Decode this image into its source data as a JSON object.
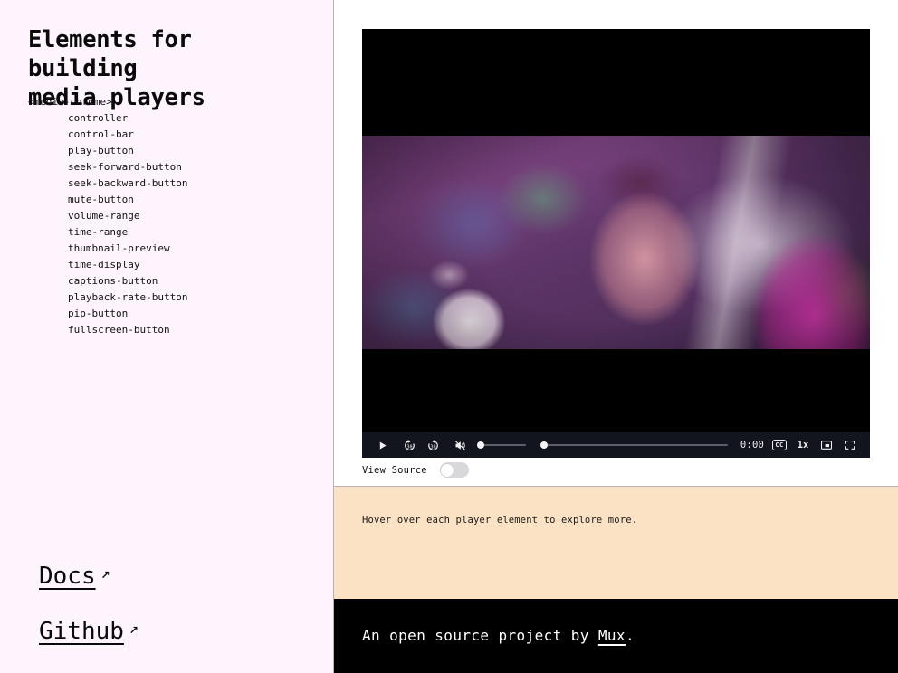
{
  "sidebar": {
    "title": "Elements for building\nmedia players",
    "tree_root": "<media-chrome>",
    "tree_items": [
      "controller",
      "control-bar",
      "play-button",
      "seek-forward-button",
      "seek-backward-button",
      "mute-button",
      "volume-range",
      "time-range",
      "thumbnail-preview",
      "time-display",
      "captions-button",
      "playback-rate-button",
      "pip-button",
      "fullscreen-button"
    ],
    "links": [
      {
        "label": "Docs",
        "arrow": "↗"
      },
      {
        "label": "Github",
        "arrow": "↗"
      }
    ]
  },
  "player": {
    "controls": {
      "play_icon": "play-icon",
      "seek_forward_icon": "seek-forward-30-icon",
      "seek_forward_seconds": "30",
      "seek_backward_icon": "seek-backward-30-icon",
      "seek_backward_seconds": "30",
      "mute_icon": "volume-muted-icon",
      "volume_range_value": "0",
      "time_range_value": "0",
      "time_display": "0:00",
      "captions_label": "CC",
      "playback_rate": "1x",
      "pip_icon": "picture-in-picture-icon",
      "fullscreen_icon": "fullscreen-icon"
    },
    "state": {
      "muted": true,
      "paused": true
    }
  },
  "view_source": {
    "label": "View Source",
    "enabled": false
  },
  "hint": {
    "text": "Hover over each player element to explore more."
  },
  "footer": {
    "prefix": "An open source project by ",
    "link": "Mux",
    "suffix": "."
  },
  "colors": {
    "sidebar_bg": "#fdf4fd",
    "panel_bg": "#ffffff",
    "hint_bg": "#fce2c4",
    "footer_bg": "#000000",
    "control_bar_bg": "#13151e",
    "divider": "#b9b0bb"
  }
}
